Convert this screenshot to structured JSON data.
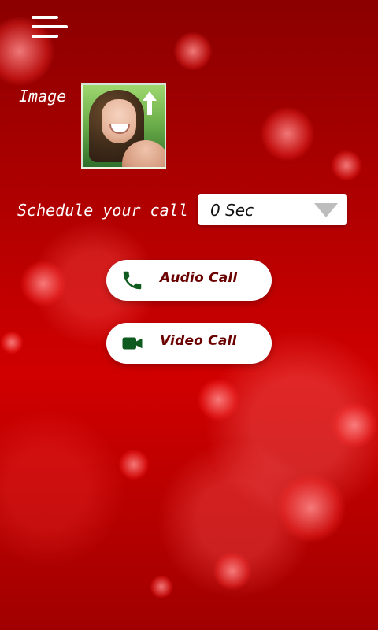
{
  "menu": {
    "icon": "menu-icon"
  },
  "image_section": {
    "label": "Image",
    "upload_icon": "upload-arrow-icon"
  },
  "schedule": {
    "label": "Schedule your call",
    "selected": "0 Sec",
    "dropdown_icon": "dropdown-arrow-icon"
  },
  "actions": {
    "audio": {
      "label": "Audio Call",
      "icon": "phone-icon"
    },
    "video": {
      "label": "Video Call",
      "icon": "video-camera-icon"
    }
  },
  "colors": {
    "accent_text": "#6b0000",
    "icon_green": "#0f5a1f",
    "background_red": "#b30000"
  }
}
